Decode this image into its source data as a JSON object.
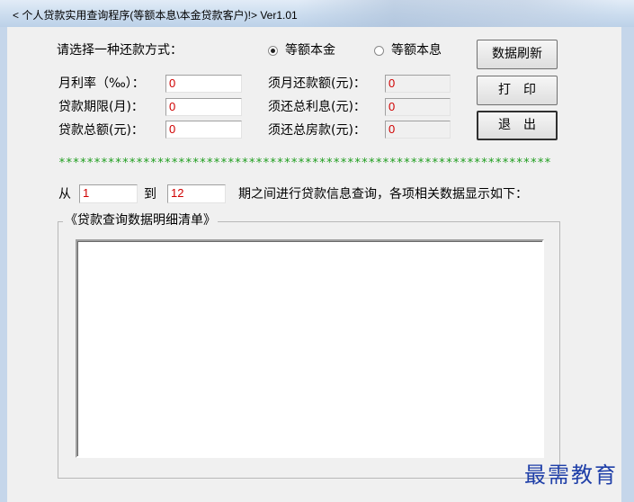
{
  "window": {
    "title": "< 个人贷款实用查询程序(等额本息\\本金贷款客户)!> Ver1.01"
  },
  "repayment": {
    "prompt": "请选择一种还款方式：",
    "options": [
      {
        "label": "等额本金",
        "selected": true
      },
      {
        "label": "等额本息",
        "selected": false
      }
    ]
  },
  "inputs": {
    "monthly_rate": {
      "label": "月利率（‰）：",
      "value": "0"
    },
    "loan_term": {
      "label": "贷款期限(月)：",
      "value": "0"
    },
    "loan_amount": {
      "label": "贷款总额(元)：",
      "value": "0"
    }
  },
  "outputs": {
    "monthly_payment": {
      "label": "须月还款额(元)：",
      "value": "0"
    },
    "total_interest": {
      "label": "须还总利息(元)：",
      "value": "0"
    },
    "total_repayment": {
      "label": "须还总房款(元)：",
      "value": "0"
    }
  },
  "buttons": {
    "refresh": "数据刷新",
    "print": "打　印",
    "exit": "退　出"
  },
  "separator": "**********************************************************************",
  "range": {
    "from_label": "从",
    "from_value": "1",
    "to_label": "到",
    "to_value": "12",
    "suffix": "期之间进行贷款信息查询，各项相关数据显示如下："
  },
  "details": {
    "title": "《贷款查询数据明细清单》"
  },
  "watermark": "最需教育",
  "colors": {
    "value_text": "#d00000",
    "separator": "#1f9e1f",
    "watermark": "#1f3fa8"
  }
}
